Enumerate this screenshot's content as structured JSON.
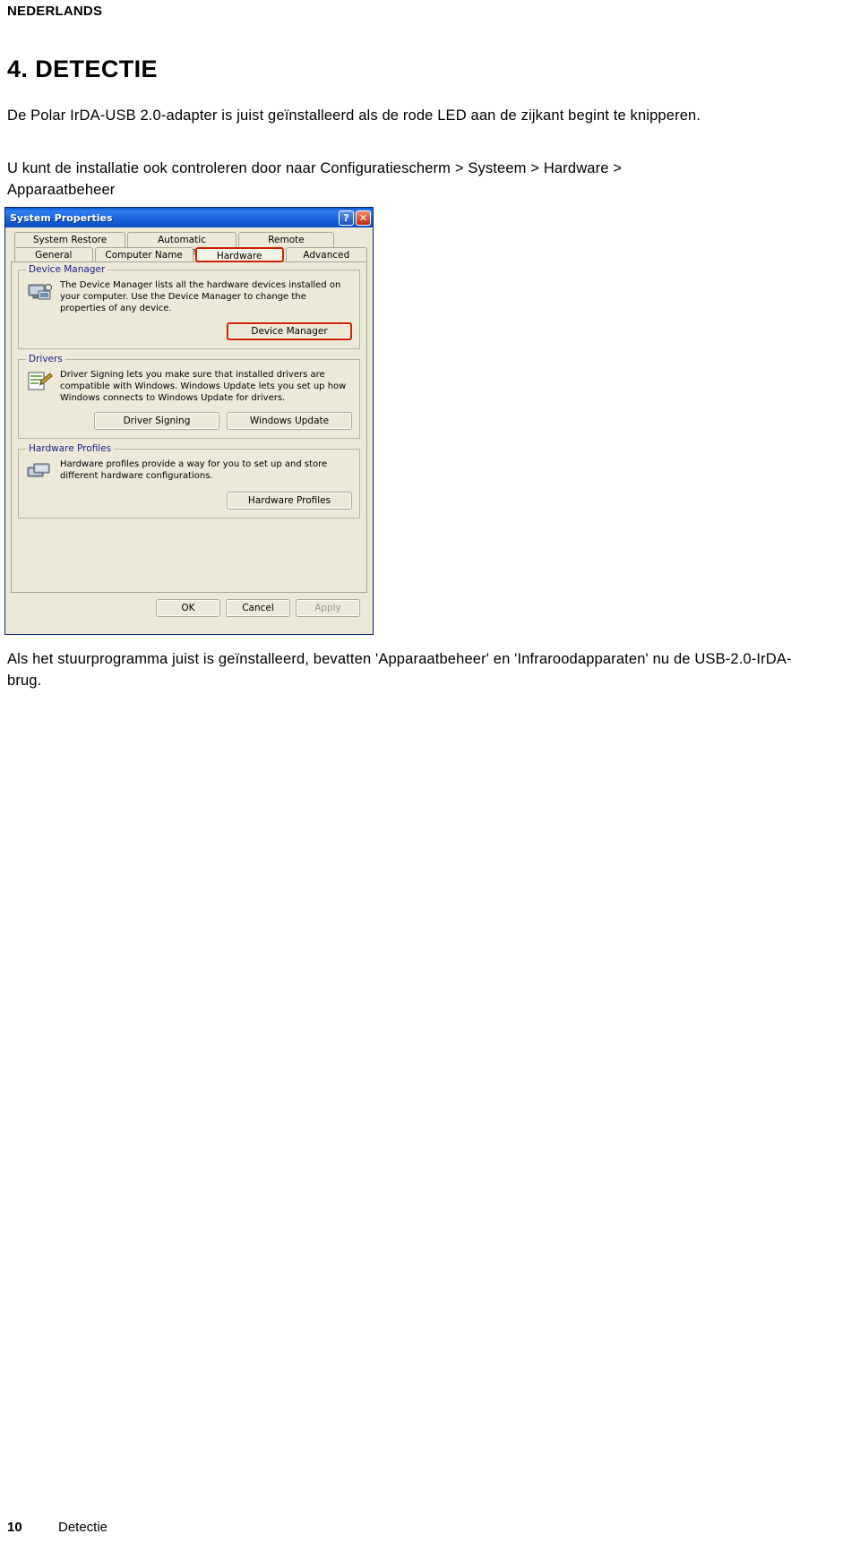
{
  "document": {
    "language_header": "NEDERLANDS",
    "chapter_title": "4. DETECTIE",
    "paragraph_1": "De Polar IrDA-USB 2.0-adapter is juist geïnstalleerd als de rode LED aan de zijkant begint te knipperen.",
    "paragraph_2": "U kunt de installatie ook controleren door naar Configuratiescherm > Systeem > Hardware > Apparaatbeheer",
    "paragraph_3": "Als het stuurprogramma juist is geïnstalleerd, bevatten 'Apparaatbeheer' en 'Infraroodapparaten' nu de USB-2.0-IrDA-brug.",
    "footer_page": "10",
    "footer_section": "Detectie"
  },
  "screenshot": {
    "window_title": "System Properties",
    "titlebar_buttons": {
      "help": "?",
      "close": "✕"
    },
    "tabs_row1": [
      "System Restore",
      "Automatic Updates",
      "Remote"
    ],
    "tabs_row2": [
      "General",
      "Computer Name",
      "Hardware",
      "Advanced"
    ],
    "selected_tab": "Hardware",
    "groups": [
      {
        "label": "Device Manager",
        "text": "The Device Manager lists all the hardware devices installed on your computer. Use the Device Manager to change the properties of any device.",
        "buttons": [
          "Device Manager"
        ]
      },
      {
        "label": "Drivers",
        "text": "Driver Signing lets you make sure that installed drivers are compatible with Windows. Windows Update lets you set up how Windows connects to Windows Update for drivers.",
        "buttons": [
          "Driver Signing",
          "Windows Update"
        ]
      },
      {
        "label": "Hardware Profiles",
        "text": "Hardware profiles provide a way for you to set up and store different hardware configurations.",
        "buttons": [
          "Hardware Profiles"
        ]
      }
    ],
    "footer_buttons": [
      "OK",
      "Cancel",
      "Apply"
    ],
    "highlight_color": "#cc2200"
  }
}
